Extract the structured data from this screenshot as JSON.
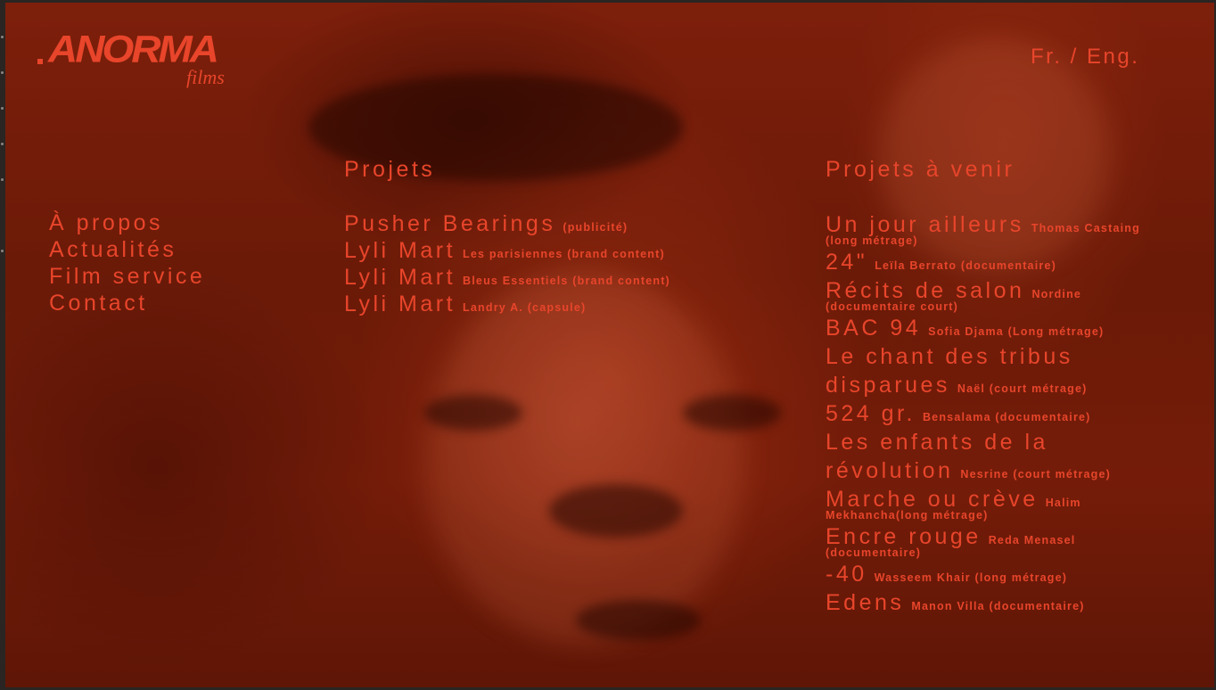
{
  "logo": {
    "word": "ANORMA",
    "sub": "films"
  },
  "lang": "Fr. / Eng.",
  "nav": [
    "À propos",
    "Actualités",
    "Film service",
    "Contact"
  ],
  "projets": {
    "title": "Projets",
    "items": [
      {
        "title": "Pusher Bearings",
        "sub": "(publicité)"
      },
      {
        "title": "Lyli Mart",
        "sub": "Les parisiennes (brand content)"
      },
      {
        "title": "Lyli Mart",
        "sub": "Bleus Essentiels (brand content)"
      },
      {
        "title": "Lyli Mart",
        "sub": "Landry A. (capsule)"
      }
    ]
  },
  "avenir": {
    "title": "Projets à venir",
    "items": [
      {
        "title": "Un jour ailleurs",
        "sub": "Thomas Castaing",
        "sub2": "(long métrage)"
      },
      {
        "title": "24\"",
        "sub": "Leïla Berrato (documentaire)",
        "sub2": ""
      },
      {
        "title": "Récits de salon",
        "sub": "Nordine",
        "sub2": "(documentaire court)"
      },
      {
        "title": "BAC 94",
        "sub": "Sofia Djama (Long métrage)",
        "sub2": ""
      },
      {
        "title": "Le chant des tribus",
        "sub": "",
        "sub2": ""
      },
      {
        "title": " disparues",
        "sub": "Naël (court métrage)",
        "sub2": ""
      },
      {
        "title": "524 gr.",
        "sub": "Bensalama (documentaire)",
        "sub2": ""
      },
      {
        "title": "Les enfants de la",
        "sub": "",
        "sub2": ""
      },
      {
        "title": " révolution",
        "sub": "Nesrine (court métrage)",
        "sub2": ""
      },
      {
        "title": "Marche ou crève",
        "sub": "Halim",
        "sub2": "Mekhancha(long métrage)"
      },
      {
        "title": "Encre rouge",
        "sub": "Reda Menasel",
        "sub2": "(documentaire)"
      },
      {
        "title": "-40",
        "sub": "Wasseem Khair (long métrage)",
        "sub2": ""
      },
      {
        "title": "Edens",
        "sub": "Manon Villa (documentaire)",
        "sub2": ""
      }
    ]
  },
  "colors": {
    "accent": "#e8452b",
    "background": "#6b1a08"
  }
}
